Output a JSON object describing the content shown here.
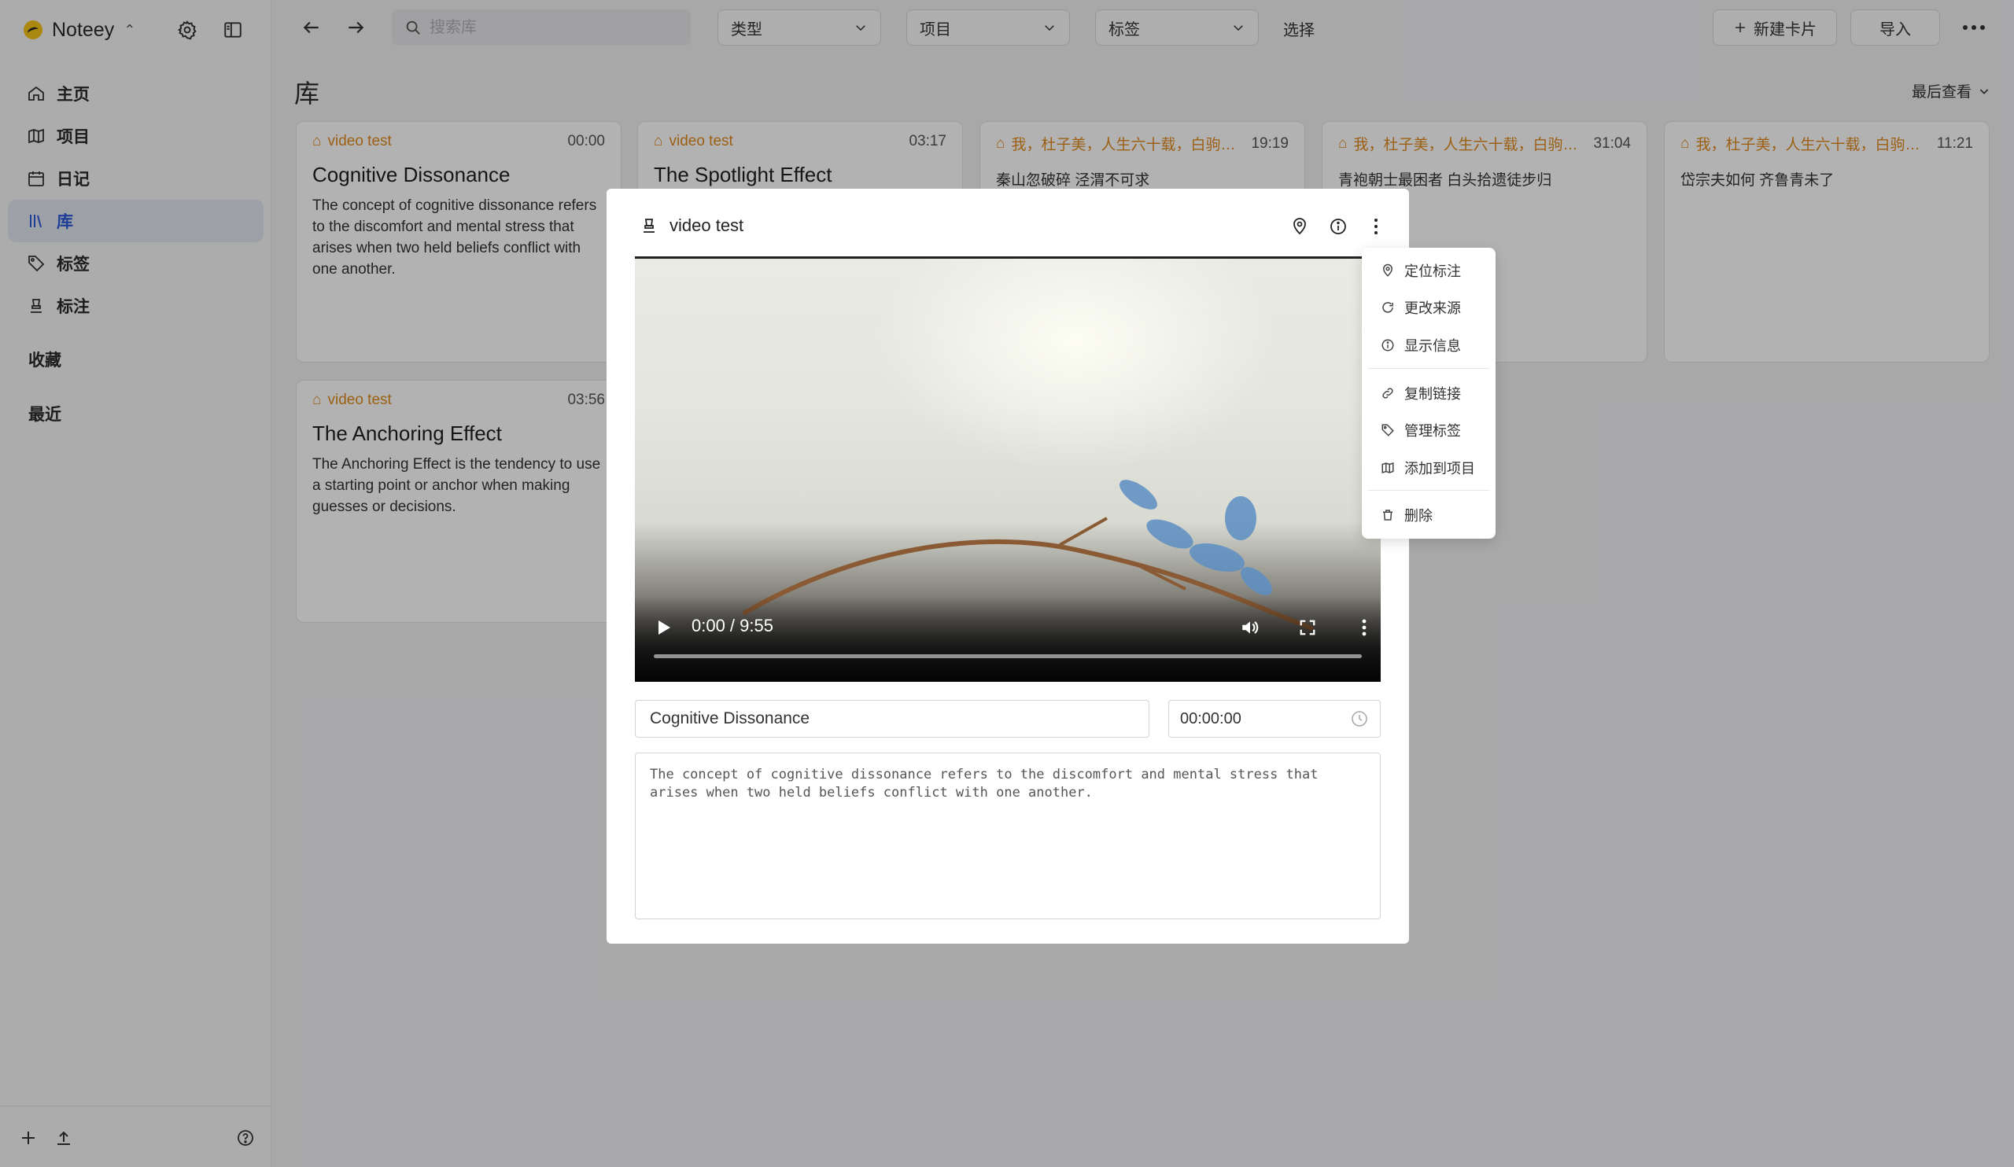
{
  "app": {
    "name": "Noteey"
  },
  "sidebar": {
    "items": [
      {
        "label": "主页",
        "icon": "home-icon"
      },
      {
        "label": "项目",
        "icon": "map-icon"
      },
      {
        "label": "日记",
        "icon": "calendar-icon"
      },
      {
        "label": "库",
        "icon": "library-icon",
        "active": true
      },
      {
        "label": "标签",
        "icon": "tag-icon"
      },
      {
        "label": "标注",
        "icon": "highlighter-icon"
      }
    ],
    "sections": {
      "favorites": "收藏",
      "recent": "最近"
    }
  },
  "toolbar": {
    "search_placeholder": "搜索库",
    "filters": [
      "类型",
      "项目",
      "标签"
    ],
    "select_label": "选择",
    "new_card_label": "新建卡片",
    "import_label": "导入"
  },
  "page": {
    "title": "库",
    "sort_label": "最后查看"
  },
  "cards": [
    {
      "source": "video test",
      "time": "00:00",
      "title": "Cognitive Dissonance",
      "body": "The concept of cognitive dissonance refers to the discomfort and mental stress that arises when two held beliefs conflict with one another."
    },
    {
      "source": "video test",
      "time": "03:17",
      "title": "The Spotlight Effect",
      "body": ""
    },
    {
      "source": "我，杜子美，人生六十载，白驹过隙...",
      "time": "19:19",
      "title": "",
      "body": "秦山忽破碎 泾渭不可求"
    },
    {
      "source": "我，杜子美，人生六十载，白驹过...",
      "time": "31:04",
      "title": "",
      "body": "青袍朝士最困者 白头拾遗徒步归"
    },
    {
      "source": "我，杜子美，人生六十载，白驹过隙...",
      "time": "11:21",
      "title": "",
      "body": "岱宗夫如何 齐鲁青未了"
    },
    {
      "source": "video test",
      "time": "03:56",
      "title": "The Anchoring Effect",
      "body": "The Anchoring Effect is the tendency to use a starting point or anchor when making guesses or decisions."
    }
  ],
  "modal": {
    "source_title": "video test",
    "video": {
      "time_display": "0:00 / 9:55",
      "progress": 0
    },
    "title_value": "Cognitive Dissonance",
    "timestamp_value": "00:00:00",
    "description": "The concept of cognitive dissonance refers to the discomfort and mental stress that arises when two held beliefs conflict with one another."
  },
  "context_menu": {
    "items": [
      {
        "label": "定位标注",
        "icon": "location-pin-icon"
      },
      {
        "label": "更改来源",
        "icon": "refresh-icon"
      },
      {
        "label": "显示信息",
        "icon": "info-icon"
      },
      {
        "label": "复制链接",
        "icon": "link-icon"
      },
      {
        "label": "管理标签",
        "icon": "tag-icon"
      },
      {
        "label": "添加到项目",
        "icon": "map-icon"
      },
      {
        "label": "删除",
        "icon": "trash-icon"
      }
    ]
  },
  "colors": {
    "accent": "#2a5bd7",
    "source_orange": "#e08a1e",
    "brand_yellow": "#f5c518"
  }
}
